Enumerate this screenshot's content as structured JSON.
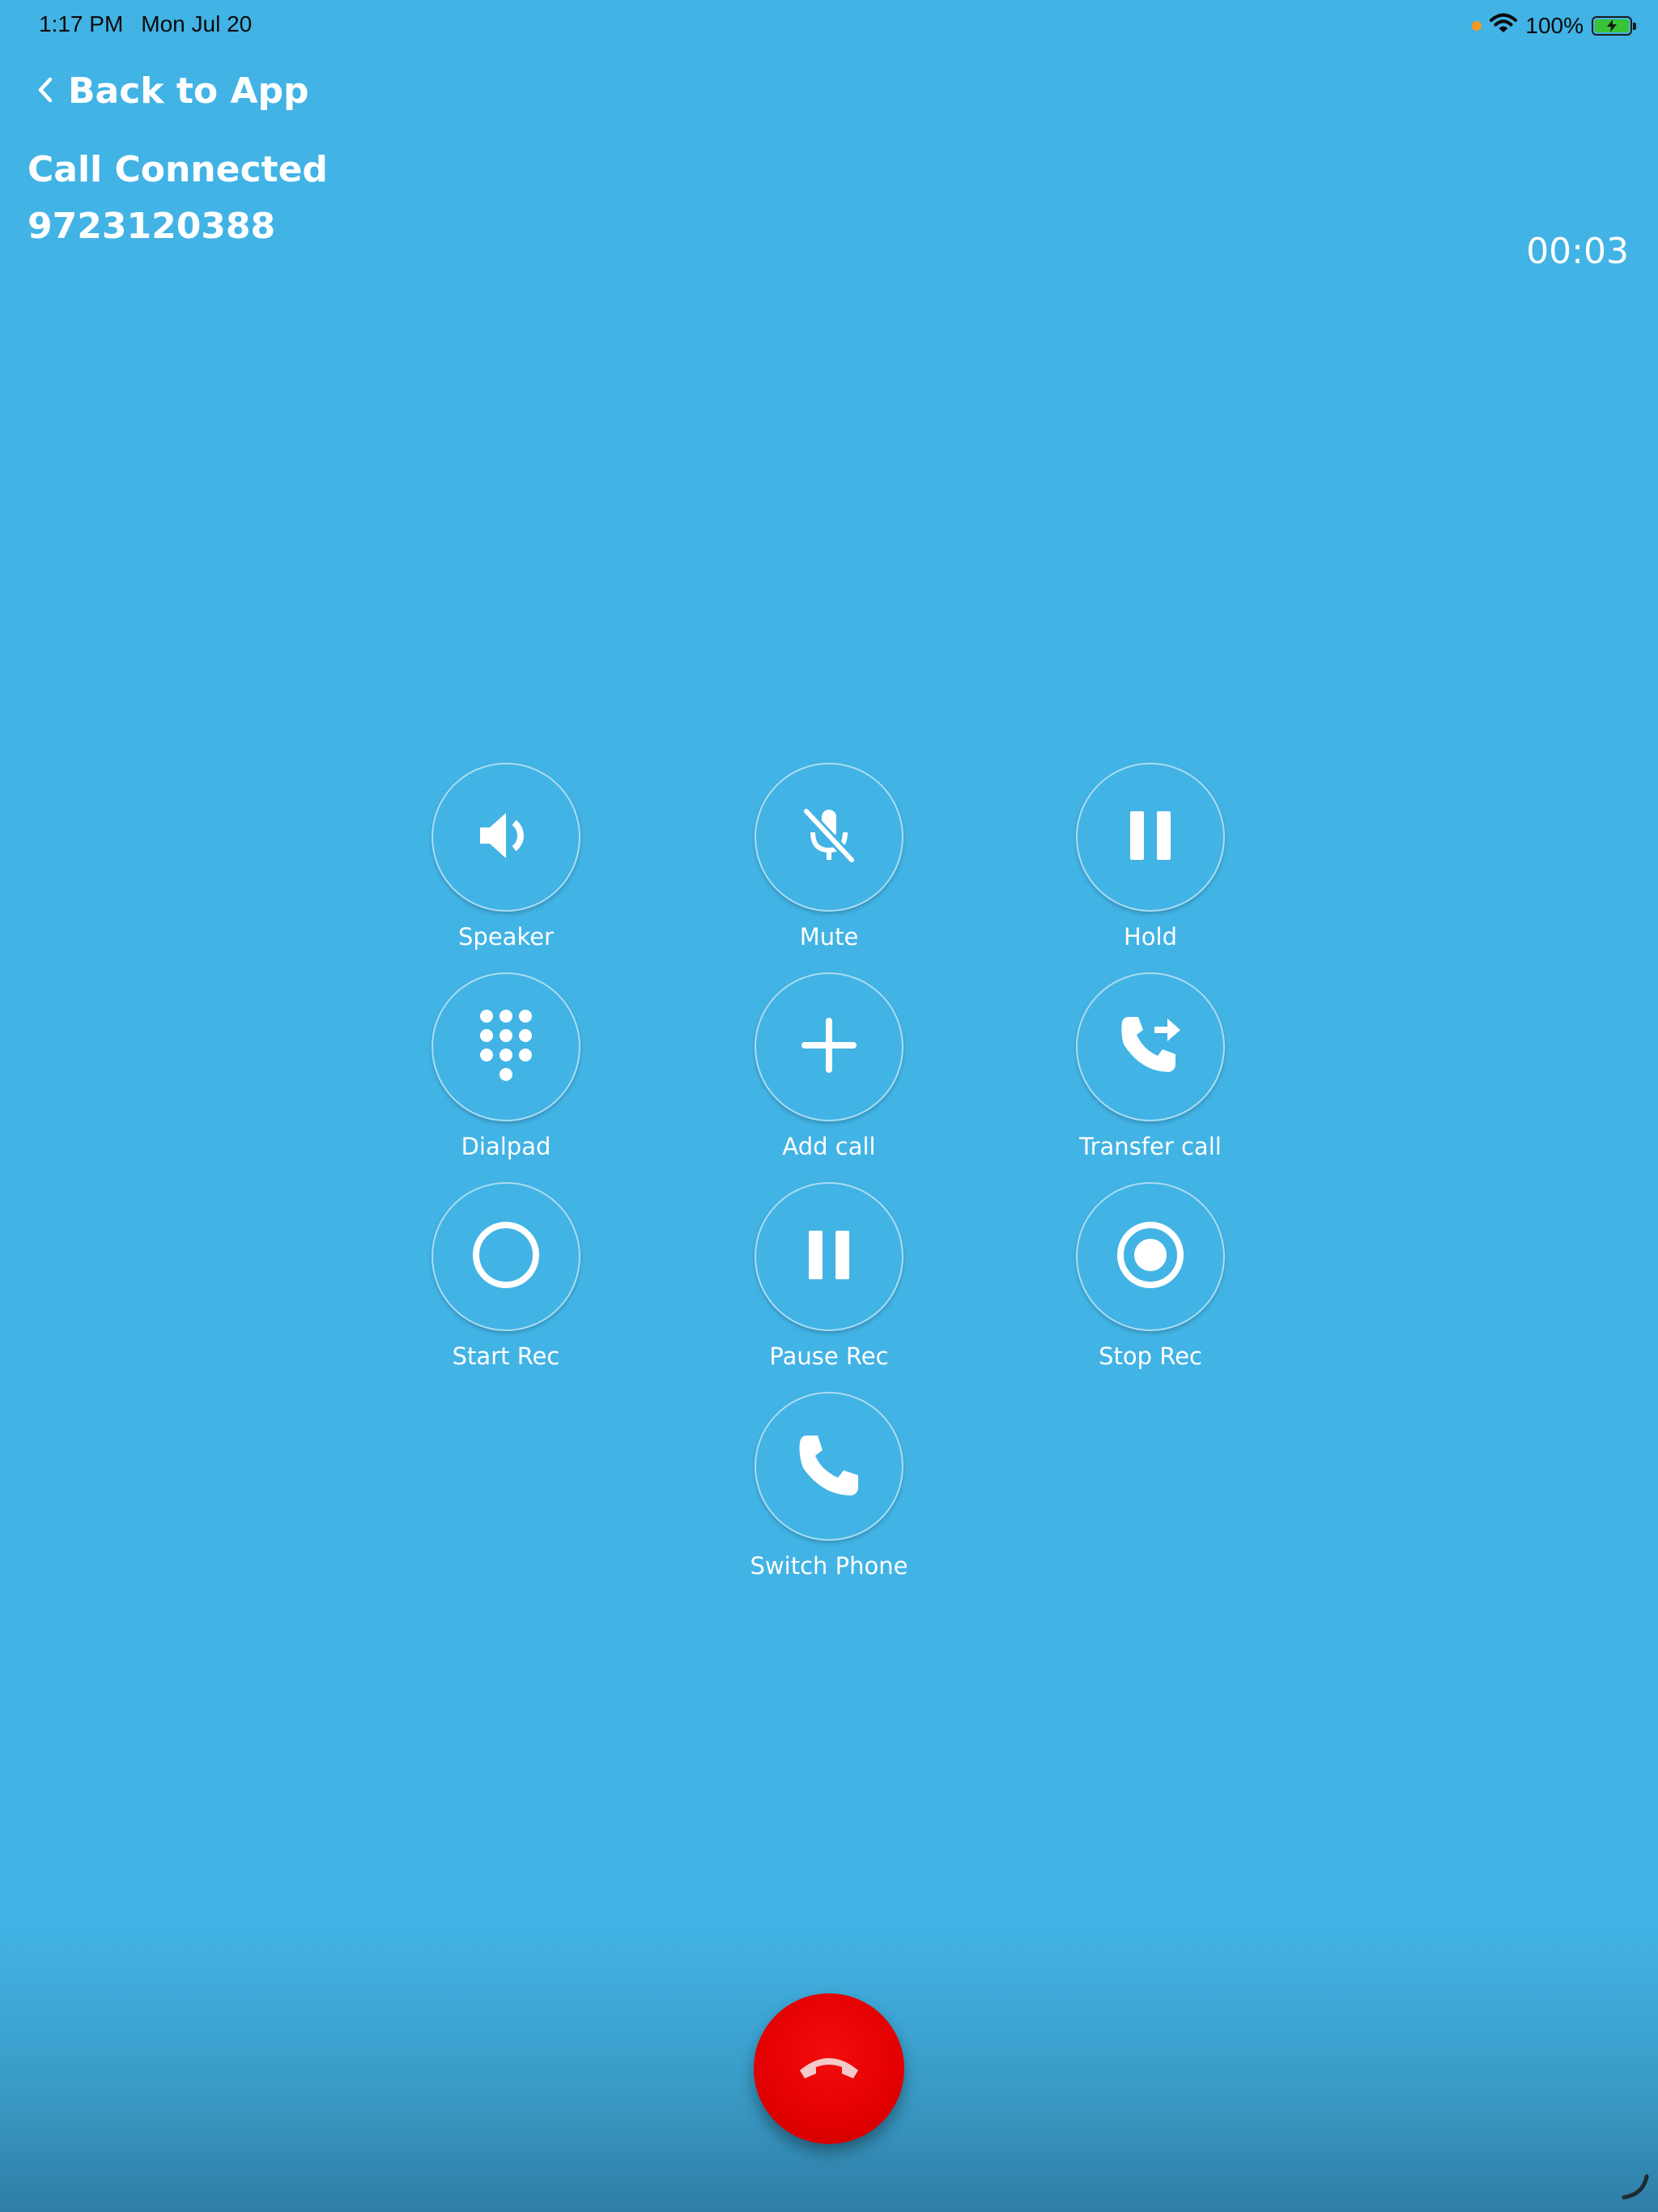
{
  "status_bar": {
    "time": "1:17 PM",
    "date": "Mon Jul 20",
    "battery": "100%"
  },
  "header": {
    "back_label": "Back to App",
    "call_status": "Call Connected",
    "phone_number": "9723120388",
    "timer": "00:03"
  },
  "controls": {
    "speaker": "Speaker",
    "mute": "Mute",
    "hold": "Hold",
    "dialpad": "Dialpad",
    "add_call": "Add call",
    "transfer_call": "Transfer call",
    "start_rec": "Start Rec",
    "pause_rec": "Pause Rec",
    "stop_rec": "Stop Rec",
    "switch_phone": "Switch Phone"
  },
  "colors": {
    "background": "#42b3e5",
    "end_call": "#e30000",
    "text": "#ffffff"
  },
  "icons": {
    "speaker": "speaker-icon",
    "mute": "mic-off-icon",
    "hold": "pause-icon",
    "dialpad": "dialpad-icon",
    "add_call": "plus-icon",
    "transfer_call": "phone-forward-icon",
    "start_rec": "record-ring-icon",
    "pause_rec": "pause-icon",
    "stop_rec": "record-dot-icon",
    "switch_phone": "phone-icon",
    "end_call": "end-call-icon"
  }
}
